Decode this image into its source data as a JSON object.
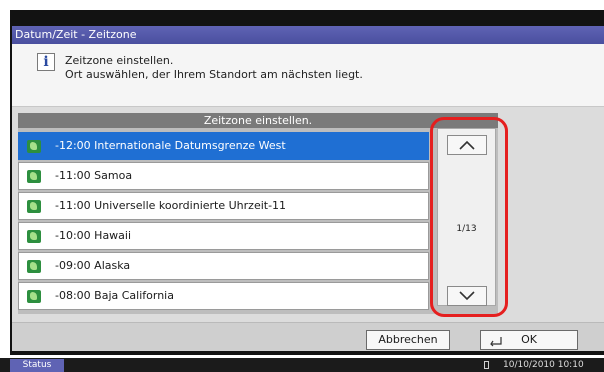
{
  "window": {
    "title": "Datum/Zeit - Zeitzone"
  },
  "info": {
    "icon": "info-icon",
    "line1": "Zeitzone einstellen.",
    "line2": "Ort auswählen, der Ihrem Standort am nächsten liegt."
  },
  "list": {
    "header": "Zeitzone einstellen.",
    "selected_color": "#1f6fd3",
    "items": [
      {
        "label": "-12:00 Internationale Datumsgrenze West",
        "icon": "globe-icon",
        "selected": true
      },
      {
        "label": "-11:00 Samoa",
        "icon": "globe-icon",
        "selected": false
      },
      {
        "label": "-11:00 Universelle koordinierte Uhrzeit-11",
        "icon": "globe-icon",
        "selected": false
      },
      {
        "label": "-10:00 Hawaii",
        "icon": "globe-icon",
        "selected": false
      },
      {
        "label": "-09:00 Alaska",
        "icon": "globe-icon",
        "selected": false
      },
      {
        "label": "-08:00 Baja California",
        "icon": "globe-icon",
        "selected": false
      }
    ]
  },
  "scroll": {
    "page_indicator": "1/13",
    "up_icon": "chevron-up-icon",
    "down_icon": "chevron-down-icon",
    "highlight_color": "#e51f1f"
  },
  "buttons": {
    "cancel": "Abbrechen",
    "ok": "OK",
    "ok_icon": "enter-icon"
  },
  "status_bar": {
    "status_label": "Status",
    "datetime": "10/10/2010  10:10",
    "sd_icon": "memory-card-icon"
  }
}
